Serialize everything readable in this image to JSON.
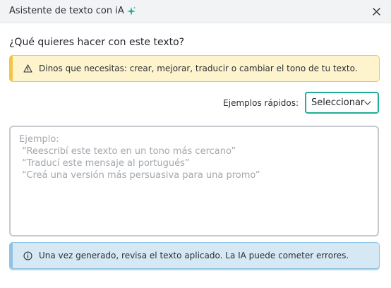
{
  "header": {
    "title": "Asistente de texto con iA",
    "sparkle_icon": "sparkle-icon",
    "close_icon": "close-icon"
  },
  "question": "¿Qué quieres hacer con este texto?",
  "warning": {
    "icon": "warning-icon",
    "text": "Dinos que necesitas: crear, mejorar, traducir o cambiar el tono de tu texto."
  },
  "examples": {
    "label": "Ejemplos rápidos:",
    "select_value": "Seleccionar",
    "chevron_icon": "chevron-down-icon"
  },
  "prompt": {
    "value": "",
    "placeholder": "Ejemplo:\n “Reescribí este texto en un tono más cercano”\n “Traducí este mensaje al portugués”\n “Creá una versión más persuasiva para una promo”"
  },
  "info": {
    "icon": "info-icon",
    "text": "Una vez generado, revisa el texto aplicado. La IA puede cometer errores."
  },
  "colors": {
    "accent": "#1fae95",
    "sparkle": "#1fae95",
    "warning_bg": "#fdf3cc",
    "warning_border": "#f1c648",
    "info_bg": "#d5e8f4",
    "info_border": "#8fc2e3"
  }
}
